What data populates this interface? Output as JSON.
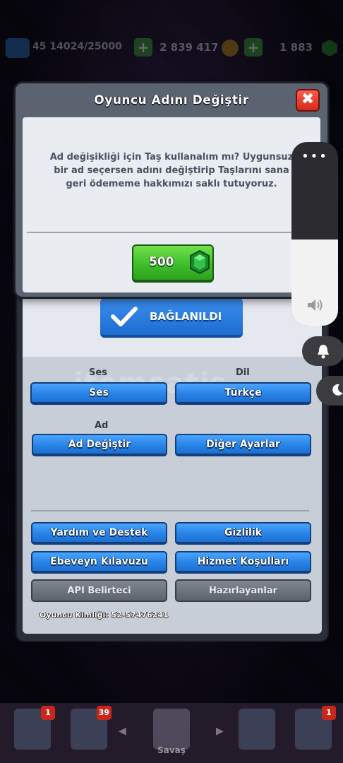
{
  "topbar": {
    "level": "45",
    "xp": "14024/25000",
    "gold": "2 839 417",
    "gems": "1 883"
  },
  "modal": {
    "title": "Oyuncu Adını Değiştir",
    "close_label": "✖",
    "message": "Ad değişikliği için Taş kullanalım mı? Uygunsuz bir ad seçersen adını değiştirip Taşlarını sana geri ödememe hakkımızı saklı tutuyoruz.",
    "price": "500"
  },
  "settings": {
    "connected_label": "BAĞLANILDI",
    "sound_section": "Ses",
    "language_section": "Dil",
    "name_section": "Ad",
    "sound_button": "Ses",
    "language_button": "Türkçe",
    "change_name_button": "Ad Değiştir",
    "other_settings_button": "Diğer Ayarlar",
    "help_button": "Yardım ve Destek",
    "privacy_button": "Gizlilik",
    "parent_guide_button": "Ebeveyn Kılavuzu",
    "terms_button": "Hizmet Koşulları",
    "api_button": "API Belirteci",
    "credits_button": "Hazırlayanlar",
    "player_id": "Oyuncu Kimliği: 52-57476241"
  },
  "watermark": {
    "text": "itemsatis"
  },
  "volume": {
    "dots": "•••",
    "level_percent": 47
  },
  "bottom_nav": {
    "battle_label": "Savaş",
    "badges": [
      "1",
      "39",
      "1"
    ]
  },
  "colors": {
    "accent_green": "#3fbf2c",
    "accent_blue": "#2b86ea",
    "close_red": "#d42a1f"
  }
}
